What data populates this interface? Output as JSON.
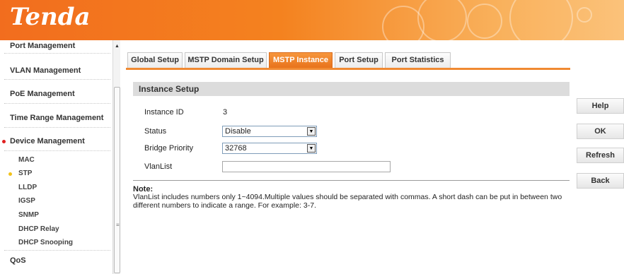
{
  "brand": {
    "logo": "Tenda"
  },
  "sidebar": {
    "items": [
      {
        "label": "Port Management"
      },
      {
        "label": "VLAN Management"
      },
      {
        "label": "PoE Management"
      },
      {
        "label": "Time Range Management"
      },
      {
        "label": "Device Management"
      }
    ],
    "sub_items": [
      {
        "label": "MAC"
      },
      {
        "label": "STP"
      },
      {
        "label": "LLDP"
      },
      {
        "label": "IGSP"
      },
      {
        "label": "SNMP"
      },
      {
        "label": "DHCP Relay"
      },
      {
        "label": "DHCP Snooping"
      }
    ],
    "after": {
      "label": "QoS"
    }
  },
  "tabs": [
    {
      "label": "Global Setup"
    },
    {
      "label": "MSTP Domain Setup"
    },
    {
      "label": "MSTP Instance"
    },
    {
      "label": "Port Setup"
    },
    {
      "label": "Port Statistics"
    }
  ],
  "panel": {
    "title": "Instance Setup",
    "instance_id_label": "Instance ID",
    "instance_id_value": "3",
    "status_label": "Status",
    "status_value": "Disable",
    "bridge_priority_label": "Bridge Priority",
    "bridge_priority_value": "32768",
    "vlanlist_label": "VlanList",
    "vlanlist_value": ""
  },
  "note": {
    "heading": "Note:",
    "text": "VlanList includes numbers only 1~4094.Multiple values should be separated with commas. A short dash can be put in between two different numbers to indicate a range. For example: 3-7."
  },
  "buttons": {
    "help": "Help",
    "ok": "OK",
    "refresh": "Refresh",
    "back": "Back"
  },
  "colors": {
    "accent": "#f4821f",
    "active_tab": "#e8731c"
  }
}
